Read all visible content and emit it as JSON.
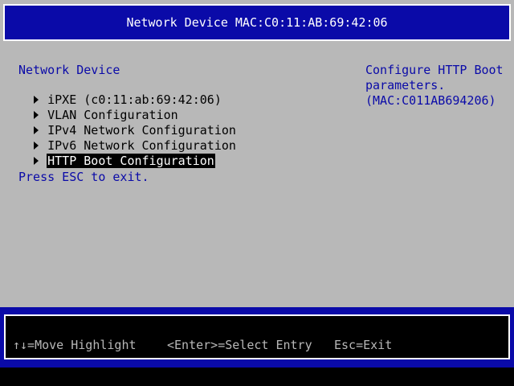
{
  "header": {
    "title": "Network Device MAC:C0:11:AB:69:42:06"
  },
  "main": {
    "section_title": "Network Device",
    "menu_items": [
      {
        "label": "iPXE (c0:11:ab:69:42:06)",
        "selected": false
      },
      {
        "label": "VLAN Configuration",
        "selected": false
      },
      {
        "label": "IPv4 Network Configuration",
        "selected": false
      },
      {
        "label": "IPv6 Network Configuration",
        "selected": false
      },
      {
        "label": "HTTP Boot Configuration",
        "selected": true
      }
    ],
    "press_esc": "Press ESC to exit."
  },
  "help": {
    "lines": [
      "Configure HTTP Boot",
      "parameters.",
      "(MAC:C011AB694206)"
    ]
  },
  "footer": {
    "move_highlight": "↑↓=Move Highlight",
    "select_entry": "<Enter>=Select Entry",
    "esc_exit": "Esc=Exit"
  },
  "colors": {
    "background": "#b8b8b8",
    "blue": "#0a0aa8",
    "white": "#ffffff",
    "black": "#000000"
  },
  "icons": {
    "menu_marker": "right-triangle-icon"
  }
}
